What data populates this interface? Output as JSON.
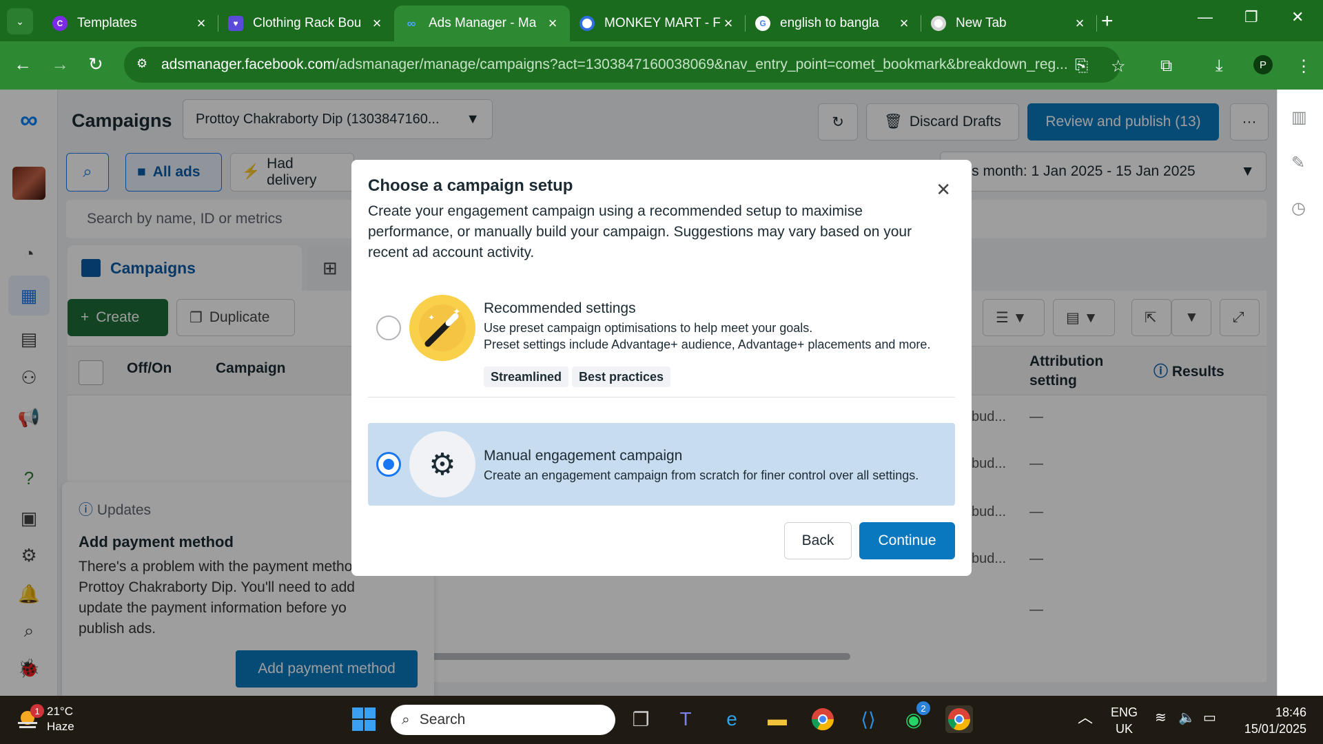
{
  "browser": {
    "tabs": [
      {
        "title": "Templates",
        "icon": "canva-icon",
        "color": "#7d2ae8"
      },
      {
        "title": "Clothing Rack Bou",
        "icon": "heart-icon",
        "color": "#5b4bdb"
      },
      {
        "title": "Ads Manager - Ma",
        "icon": "meta-icon",
        "color": "#0081fb",
        "active": true
      },
      {
        "title": "MONKEY MART - F",
        "icon": "monkey-icon",
        "color": "#2f6fe0"
      },
      {
        "title": "english to bangla",
        "icon": "google-icon",
        "color": "#4285f4"
      },
      {
        "title": "New Tab",
        "icon": "chrome-icon",
        "color": "#ffffff"
      }
    ],
    "url_host": "adsmanager.facebook.com",
    "url_path": "/adsmanager/manage/campaigns?act=1303847160038069&nav_entry_point=comet_bookmark&breakdown_reg...",
    "profile_initial": "P"
  },
  "header": {
    "title": "Campaigns",
    "account": "Prottoy Chakraborty Dip (1303847160...",
    "discard": "Discard Drafts",
    "review": "Review and publish (13)",
    "more": "···"
  },
  "filters": {
    "all_ads": "All ads",
    "had_delivery": "Had delivery",
    "date_range": "This month: 1 Jan 2025 - 15 Jan 2025",
    "search_placeholder": "Search by name, ID or metrics"
  },
  "tabs": {
    "campaigns": "Campaigns"
  },
  "toolbar": {
    "create": "Create",
    "duplicate": "Duplicate"
  },
  "table": {
    "headers": {
      "offon": "Off/On",
      "campaign": "Campaign",
      "attribution": "Attribution setting",
      "results": "Results"
    },
    "rows": [
      {
        "budget": "bud...",
        "attribution": "—"
      },
      {
        "budget": "bud...",
        "attribution": "—"
      },
      {
        "budget": "bud...",
        "attribution": "—"
      },
      {
        "budget": "bud...",
        "attribution": "—"
      },
      {
        "budget": "",
        "attribution": "—"
      }
    ]
  },
  "updates": {
    "label": "Updates",
    "title": "Add payment method",
    "body_lines": [
      "There's a problem with the payment metho",
      "Prottoy Chakraborty Dip. You'll need to add",
      "update the payment information before yo",
      "publish ads."
    ],
    "button": "Add payment method"
  },
  "modal": {
    "title": "Choose a campaign setup",
    "description_lines": [
      "Create your engagement campaign using a recommended setup to maximise",
      "performance, or manually build your campaign. Suggestions may vary based on your",
      "recent ad account activity."
    ],
    "options": [
      {
        "title": "Recommended settings",
        "lines": [
          "Use preset campaign optimisations to help meet your goals.",
          "Preset settings include Advantage+ audience, Advantage+ placements and more."
        ],
        "tags": [
          "Streamlined",
          "Best practices"
        ],
        "selected": false
      },
      {
        "title": "Manual engagement campaign",
        "lines": [
          "Create an engagement campaign from scratch for finer control over all settings."
        ],
        "tags": [],
        "selected": true
      }
    ],
    "back": "Back",
    "continue": "Continue"
  },
  "taskbar": {
    "notification_count": "1",
    "temperature": "21°C",
    "weather": "Haze",
    "search": "Search",
    "whatsapp_badge": "2",
    "lang_top": "ENG",
    "lang_bottom": "UK",
    "time": "18:46",
    "date": "15/01/2025"
  }
}
